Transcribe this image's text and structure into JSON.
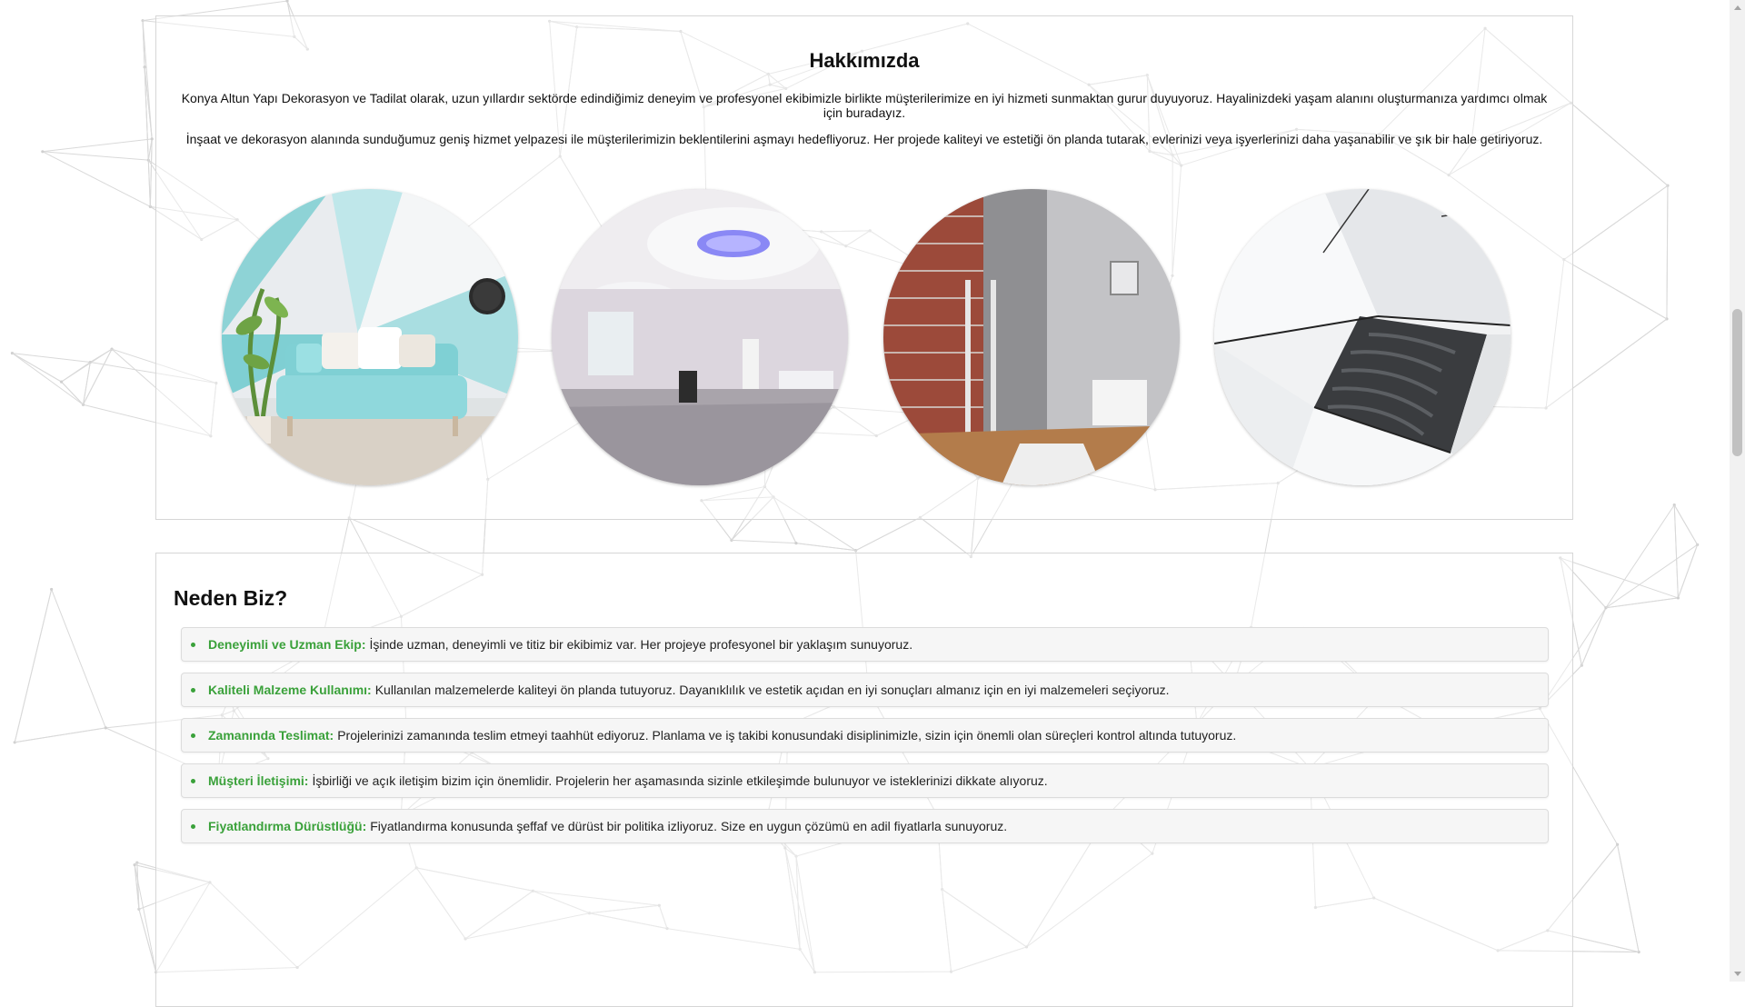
{
  "about": {
    "title": "Hakkımızda",
    "paragraphs": [
      "Konya Altun Yapı Dekorasyon ve Tadilat olarak, uzun yıllardır sektörde edindiğimiz deneyim ve profesyonel ekibimizle birlikte müşterilerimize en iyi hizmeti sunmaktan gurur duyuyoruz. Hayalinizdeki yaşam alanını oluşturmanıza yardımcı olmak için buradayız.",
      "İnşaat ve dekorasyon alanında sunduğumuz geniş hizmet yelpazesi ile müşterilerimizin beklentilerini aşmayı hedefliyoruz. Her projede kaliteyi ve estetiği ön planda tutarak, evlerinizi veya işyerlerinizi daha yaşanabilir ve şık bir hale getiriyoruz."
    ],
    "images": [
      "living-room-turquoise-sofa",
      "gypsum-ceiling-lights-room",
      "brick-wall-renovation",
      "tile-adhesive-laying"
    ]
  },
  "why": {
    "title": "Neden Biz?",
    "items": [
      {
        "head": "Deneyimli ve Uzman Ekip:",
        "text": "İşinde uzman, deneyimli ve titiz bir ekibimiz var. Her projeye profesyonel bir yaklaşım sunuyoruz."
      },
      {
        "head": "Kaliteli Malzeme Kullanımı:",
        "text": "Kullanılan malzemelerde kaliteyi ön planda tutuyoruz. Dayanıklılık ve estetik açıdan en iyi sonuçları almanız için en iyi malzemeleri seçiyoruz."
      },
      {
        "head": "Zamanında Teslimat:",
        "text": "Projelerinizi zamanında teslim etmeyi taahhüt ediyoruz. Planlama ve iş takibi konusundaki disiplinimizle, sizin için önemli olan süreçleri kontrol altında tutuyoruz."
      },
      {
        "head": "Müşteri İletişimi:",
        "text": "İşbirliği ve açık iletişim bizim için önemlidir. Projelerin her aşamasında sizinle etkileşimde bulunuyor ve isteklerinizi dikkate alıyoruz."
      },
      {
        "head": "Fiyatlandırma Dürüstlüğü:",
        "text": "Fiyatlandırma konusunda şeffaf ve dürüst bir politika izliyoruz. Size en uygun çözümü en adil fiyatlarla sunuyoruz."
      }
    ]
  },
  "colors": {
    "accent": "#3aa13a",
    "border": "#d6d6d6",
    "item_bg": "#f6f6f6"
  }
}
